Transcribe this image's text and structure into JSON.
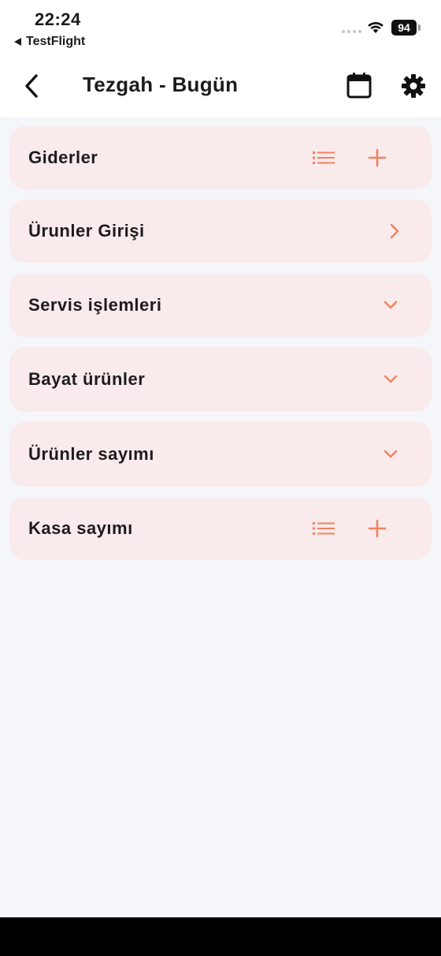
{
  "status_bar": {
    "time": "22:24",
    "back_app": "TestFlight",
    "battery": "94"
  },
  "navbar": {
    "title": "Tezgah - Bugün",
    "icons": [
      "back-chevron-icon",
      "calendar-icon",
      "gear-icon"
    ]
  },
  "sections": [
    {
      "label": "Giderler",
      "actions": [
        "list-icon",
        "plus-icon"
      ]
    },
    {
      "label": "Ürunler Girişi",
      "actions": [
        "chevron-right-icon"
      ]
    },
    {
      "label": "Servis işlemleri",
      "actions": [
        "chevron-down-icon"
      ]
    },
    {
      "label": "Bayat ürünler",
      "actions": [
        "chevron-down-icon"
      ]
    },
    {
      "label": "Ürünler sayımı",
      "actions": [
        "chevron-down-icon"
      ]
    },
    {
      "label": "Kasa sayımı",
      "actions": [
        "list-icon",
        "plus-icon"
      ]
    }
  ],
  "colors": {
    "accent": "#f0825c",
    "card_bg": "#f9eaec",
    "page_bg": "#f5f6fa"
  }
}
